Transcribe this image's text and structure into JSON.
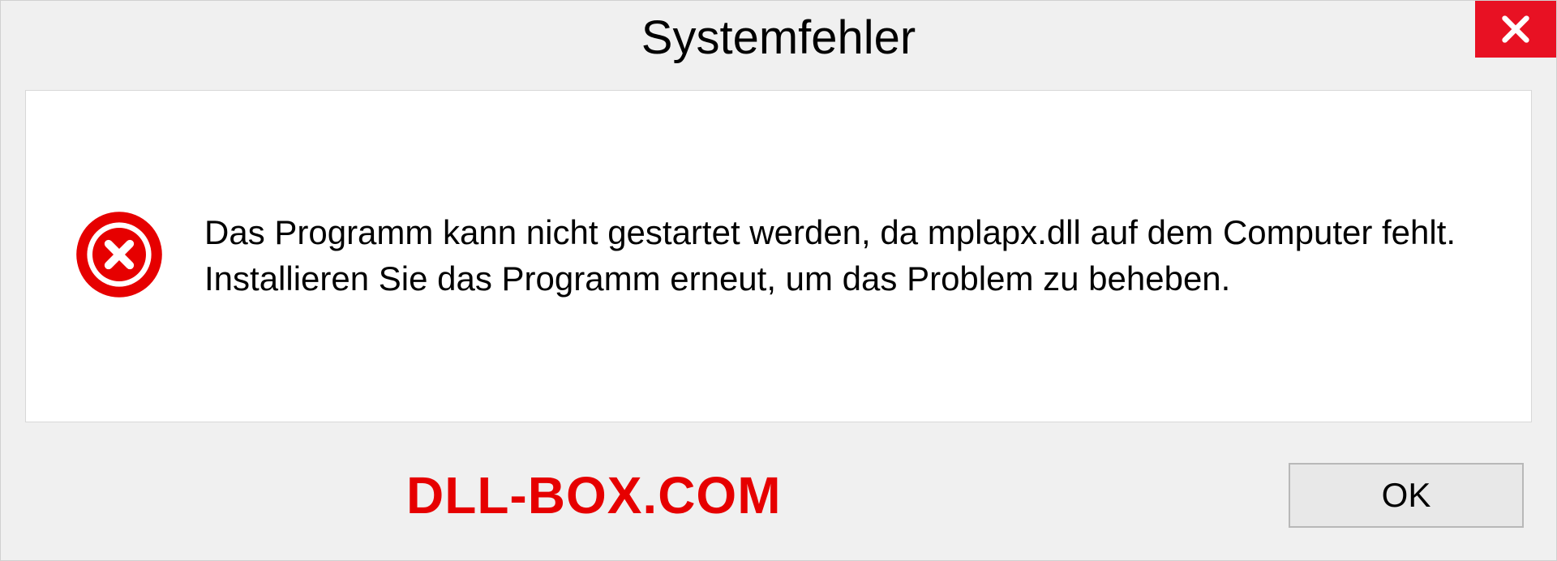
{
  "dialog": {
    "title": "Systemfehler",
    "message": "Das Programm kann nicht gestartet werden, da mplapx.dll auf dem Computer fehlt. Installieren Sie das Programm erneut, um das Problem zu beheben.",
    "ok_label": "OK"
  },
  "watermark": "DLL-BOX.COM"
}
